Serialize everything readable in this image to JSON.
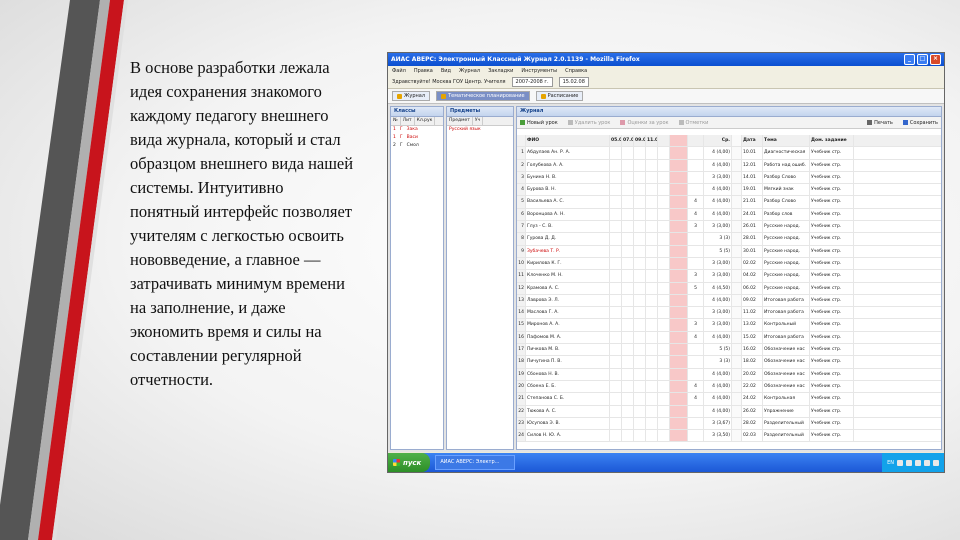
{
  "slide": {
    "text": "В основе разработки лежала идея сохранения знакомого каждому педагогу внешнего вида журнала, который и стал образцом внешнего вида нашей системы. Интуитивно понятный интерфейс позволяет учителям с легкостью освоить нововведение, а главное — затрачивать минимум времени на заполнение, и даже экономить время и силы на составлении регулярной отчетности."
  },
  "window": {
    "title": "АИАС АВЕРС: Электронный Классный Журнал 2.0.1139 - Mozilla Firefox",
    "menu": [
      "Файл",
      "Правка",
      "Вид",
      "Журнал",
      "Закладки",
      "Инструменты",
      "Справка"
    ],
    "toolbar": {
      "org": "Здравствуйте! Москва ГОУ Центр. Учителя",
      "year": "2007-2008 г.",
      "date": "15.02.08"
    },
    "tabs": [
      {
        "label": "Журнал",
        "active": false
      },
      {
        "label": "Тематическое планирование",
        "active": false
      },
      {
        "label": "Расписание",
        "active": false
      }
    ]
  },
  "classes_pane": {
    "title": "Классы",
    "headers": [
      "№",
      "Лит",
      "Кл.рук",
      "Уч."
    ],
    "rows": [
      {
        "n": "1",
        "a": "Г",
        "b": "Зака",
        "red": true
      },
      {
        "n": "1",
        "a": "Г",
        "b": "Васи",
        "red": true
      },
      {
        "n": "2",
        "a": "Г",
        "b": "Смол",
        "red": false
      }
    ]
  },
  "subjects_pane": {
    "title": "Предметы",
    "headers": [
      "Предмет",
      "Уч"
    ],
    "rows": [
      {
        "name": "Русский язык",
        "red": true
      }
    ]
  },
  "journal_pane": {
    "title": "Журнал",
    "tools": [
      "Новый урок",
      "Удалить урок",
      "Оценки за урок",
      "Отметки",
      "Печать",
      "Сохранить"
    ],
    "header": {
      "name": "ФИО",
      "dates": [
        "05.01",
        "07.01",
        "09.01",
        "11.01"
      ],
      "avg": "Ср.",
      "date": "Дата",
      "topic": "Тема",
      "hw": "Дом. задание"
    },
    "rows": [
      {
        "n": "1",
        "name": "Абдулаев Ан. Р. А.",
        "grade": "",
        "avg": "4 (4,00)",
        "date": "10.01",
        "topic": "Диагностическая",
        "hw": "Учебник стр."
      },
      {
        "n": "2",
        "name": "Голубкова А. А.",
        "grade": "",
        "avg": "4 (4,00)",
        "date": "12.01",
        "topic": "Работа над ошиб.",
        "hw": "Учебник стр."
      },
      {
        "n": "3",
        "name": "Бунина Н. В.",
        "grade": "",
        "avg": "3 (3,00)",
        "date": "14.01",
        "topic": "Разбор Слово",
        "hw": "Учебник стр."
      },
      {
        "n": "4",
        "name": "Бурова В. Н.",
        "grade": "",
        "avg": "4 (4,00)",
        "date": "19.01",
        "topic": "Мягкий знак",
        "hw": "Учебник стр."
      },
      {
        "n": "5",
        "name": "Васильева А. С.",
        "grade": "4",
        "avg": "4 (4,00)",
        "date": "21.01",
        "topic": "Разбор Слово",
        "hw": "Учебник стр."
      },
      {
        "n": "6",
        "name": "Воронцова А. Н.",
        "grade": "4",
        "avg": "4 (4,00)",
        "date": "24.01",
        "topic": "Разбор слов",
        "hw": "Учебник стр."
      },
      {
        "n": "7",
        "name": "Глуз - С. В.",
        "grade": "3",
        "avg": "3 (3,00)",
        "date": "26.01",
        "topic": "Русские народ.",
        "hw": "Учебник стр."
      },
      {
        "n": "8",
        "name": "Гурова Д. Д.",
        "grade": "",
        "avg": "3 (3)",
        "date": "28.01",
        "topic": "Русские народ.",
        "hw": "Учебник стр."
      },
      {
        "n": "9",
        "name": "Зубачева Т. Р.",
        "grade": "",
        "avg": "5 (5)",
        "date": "30.01",
        "topic": "Русские народ.",
        "hw": "Учебник стр.",
        "red": true
      },
      {
        "n": "10",
        "name": "Кирилова К. Г.",
        "grade": "",
        "avg": "3 (3,00)",
        "date": "02.02",
        "topic": "Русские народ.",
        "hw": "Учебник стр."
      },
      {
        "n": "11",
        "name": "Клоченко М. Н.",
        "grade": "3",
        "avg": "3 (3,00)",
        "date": "04.02",
        "topic": "Русские народ.",
        "hw": "Учебник стр."
      },
      {
        "n": "12",
        "name": "Крамова А. С.",
        "grade": "5",
        "avg": "4 (4,50)",
        "date": "06.02",
        "topic": "Русские народ.",
        "hw": "Учебник стр."
      },
      {
        "n": "13",
        "name": "Лаврова Э. Л.",
        "grade": "",
        "avg": "4 (4,00)",
        "date": "09.02",
        "topic": "Итоговая работа",
        "hw": "Учебник стр."
      },
      {
        "n": "14",
        "name": "Маслова Г. А.",
        "grade": "",
        "avg": "3 (3,00)",
        "date": "11.02",
        "topic": "Итоговая работа",
        "hw": "Учебник стр."
      },
      {
        "n": "15",
        "name": "Миронов А. А.",
        "grade": "3",
        "avg": "3 (3,00)",
        "date": "13.02",
        "topic": "Контрольный",
        "hw": "Учебник стр."
      },
      {
        "n": "16",
        "name": "Пафомов М. А.",
        "grade": "4",
        "avg": "4 (4,00)",
        "date": "15.02",
        "topic": "Итоговая работа",
        "hw": "Учебник стр."
      },
      {
        "n": "17",
        "name": "Пичкова М. В.",
        "grade": "",
        "avg": "5 (5)",
        "date": "16.02",
        "topic": "Обозначение нас",
        "hw": "Учебник стр."
      },
      {
        "n": "18",
        "name": "Пичугина П. В.",
        "grade": "",
        "avg": "3 (3)",
        "date": "18.02",
        "topic": "Обозначение нас",
        "hw": "Учебник стр."
      },
      {
        "n": "19",
        "name": "Сбонова Н. В.",
        "grade": "",
        "avg": "4 (4,00)",
        "date": "20.02",
        "topic": "Обозначение нас",
        "hw": "Учебник стр."
      },
      {
        "n": "20",
        "name": "Сбоена Е. Б.",
        "grade": "4",
        "avg": "4 (4,00)",
        "date": "22.02",
        "topic": "Обозначение нас",
        "hw": "Учебник стр."
      },
      {
        "n": "21",
        "name": "Степанова С. Б.",
        "grade": "4",
        "avg": "4 (4,00)",
        "date": "24.02",
        "topic": "Контрольная",
        "hw": "Учебник стр."
      },
      {
        "n": "22",
        "name": "Тюкова А. С.",
        "grade": "",
        "avg": "4 (4,00)",
        "date": "26.02",
        "topic": "Упражнение",
        "hw": "Учебник стр."
      },
      {
        "n": "23",
        "name": "Юсупова Э. В.",
        "grade": "",
        "avg": "3 (3,67)",
        "date": "28.02",
        "topic": "Разделительный",
        "hw": "Учебник стр."
      },
      {
        "n": "24",
        "name": "Силов Н. Ю. А.",
        "grade": "",
        "avg": "3 (3,50)",
        "date": "02.03",
        "topic": "Разделительный",
        "hw": "Учебник стр."
      }
    ]
  },
  "taskbar": {
    "start": "пуск",
    "task": "АИАС АВЕРС: Электр...",
    "lang": "EN"
  },
  "colors": {
    "accent_red": "#c8141c",
    "dark_stripe": "#3a3a3a",
    "xp_blue": "#1c58d6"
  }
}
